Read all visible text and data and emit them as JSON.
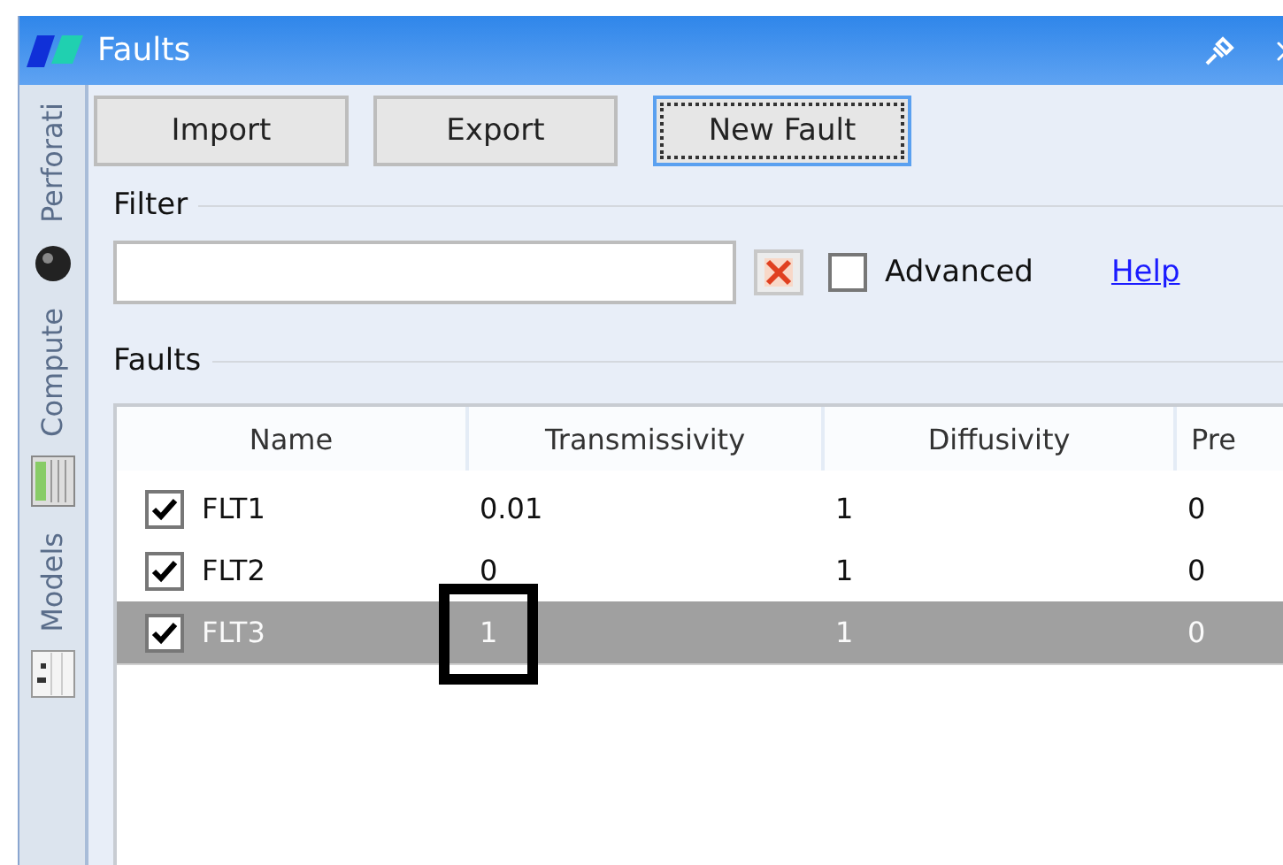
{
  "window": {
    "title": "Faults"
  },
  "side_tabs": [
    {
      "label": "Perforati",
      "kind": "ball"
    },
    {
      "label": "Compute",
      "kind": "grid"
    },
    {
      "label": "Models",
      "kind": "sheet"
    }
  ],
  "toolbar": [
    {
      "label": "Import",
      "focused": false
    },
    {
      "label": "Export",
      "focused": false
    },
    {
      "label": "New Fault",
      "focused": true
    }
  ],
  "filter": {
    "title": "Filter",
    "advanced": {
      "label": "Advanced",
      "checked": false
    },
    "help": "Help"
  },
  "faults": {
    "title": "Faults",
    "columns": [
      "Name",
      "Transmissivity",
      "Diffusivity",
      "Pre"
    ],
    "rows": [
      {
        "checked": true,
        "selected": false,
        "name": "FLT1",
        "values": [
          {
            "text": "0.01",
            "boxed": false
          },
          {
            "text": "1",
            "boxed": false
          },
          {
            "text": "0",
            "boxed": false
          }
        ]
      },
      {
        "checked": true,
        "selected": false,
        "name": "FLT2",
        "values": [
          {
            "text": "0",
            "boxed": false
          },
          {
            "text": "1",
            "boxed": false
          },
          {
            "text": "0",
            "boxed": false
          }
        ]
      },
      {
        "checked": true,
        "selected": true,
        "name": "FLT3",
        "values": [
          {
            "text": "1",
            "boxed": true
          },
          {
            "text": "1",
            "boxed": false
          },
          {
            "text": "0",
            "boxed": false
          }
        ]
      }
    ]
  }
}
